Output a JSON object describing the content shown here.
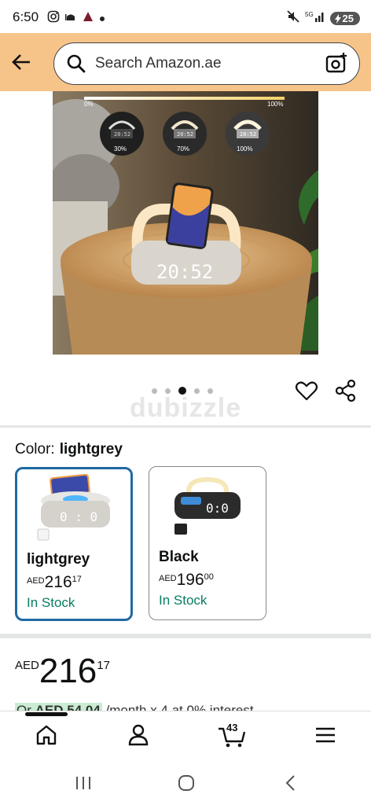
{
  "status_bar": {
    "time": "6:50",
    "battery": "25"
  },
  "header": {
    "search_placeholder": "Search Amazon.ae"
  },
  "product_image": {
    "brightness_levels": [
      "30%",
      "70%",
      "100%"
    ],
    "slider_start": "0%",
    "slider_end": "100%",
    "clock_text": "20:52",
    "carousel_count": 5,
    "carousel_active_index": 2
  },
  "watermark": "dubizzle",
  "color": {
    "label": "Color:",
    "selected": "lightgrey"
  },
  "variants": [
    {
      "name": "lightgrey",
      "currency": "AED",
      "whole": "216",
      "fraction": "17",
      "stock": "In Stock"
    },
    {
      "name": "Black",
      "currency": "AED",
      "whole": "196",
      "fraction": "00",
      "stock": "In Stock"
    }
  ],
  "price": {
    "currency": "AED",
    "whole": "216",
    "fraction": "17"
  },
  "installment": {
    "prefix": "Or ",
    "amount": "AED 54.04",
    "suffix": " /month x 4 at 0% interest"
  },
  "bottom_nav": {
    "cart_count": "43"
  },
  "colors": {
    "header_bg": "#f6c489",
    "selected_border": "#1f6aa5",
    "stock_green": "#067d62"
  }
}
